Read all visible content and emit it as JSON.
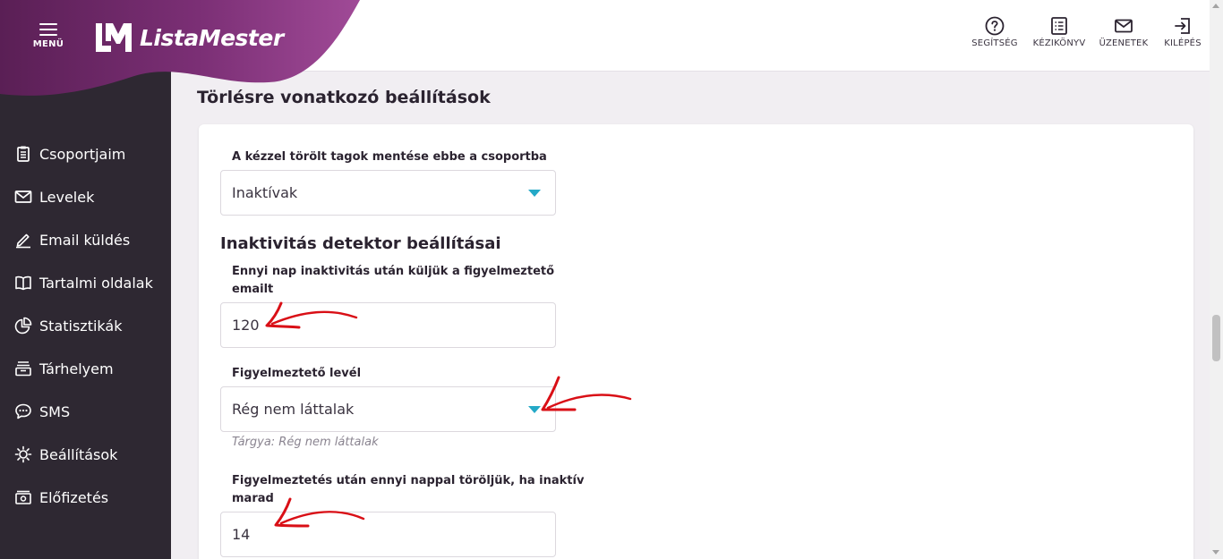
{
  "header": {
    "menu_label": "MENÜ",
    "brand": "ListaMester",
    "actions": [
      {
        "label": "SEGÍTSÉG",
        "icon": "help-circle-icon"
      },
      {
        "label": "KÉZIKÖNYV",
        "icon": "manual-list-icon"
      },
      {
        "label": "ÜZENETEK",
        "icon": "mail-icon"
      },
      {
        "label": "KILÉPÉS",
        "icon": "logout-icon"
      }
    ]
  },
  "sidebar": {
    "items": [
      {
        "label": "Csoportjaim",
        "icon": "clipboard-icon"
      },
      {
        "label": "Levelek",
        "icon": "envelope-icon"
      },
      {
        "label": "Email küldés",
        "icon": "pencil-icon"
      },
      {
        "label": "Tartalmi oldalak",
        "icon": "book-icon"
      },
      {
        "label": "Statisztikák",
        "icon": "pie-chart-icon"
      },
      {
        "label": "Tárhelyem",
        "icon": "storage-icon"
      },
      {
        "label": "SMS",
        "icon": "chat-bubble-icon"
      },
      {
        "label": "Beállítások",
        "icon": "gear-icon"
      },
      {
        "label": "Előfizetés",
        "icon": "subscription-icon"
      }
    ]
  },
  "main": {
    "section_title": "Törlésre vonatkozó beállítások",
    "deleted_members_label": "A kézzel törölt tagok mentése ebbe a csoportba",
    "deleted_members_value": "Inaktívak",
    "inactivity_heading": "Inaktivitás detektor beállításai",
    "days_label_line1": "Ennyi nap inaktivitás után küljük a figyelmeztető",
    "days_label_line2": "emailt",
    "days_value": "120",
    "warning_label": "Figyelmeztető levél",
    "warning_value": "Rég nem láttalak",
    "warning_hint": "Tárgya: Rég nem láttalak",
    "delete_label_line1": "Figyelmeztetés után ennyi nappal töröljük, ha inaktív",
    "delete_label_line2": "marad",
    "delete_value": "14"
  },
  "colors": {
    "brand_purple": "#7a2f74",
    "sidebar_bg": "#2e2832",
    "caret": "#24a9c7",
    "annotation_arrow": "#d90f16"
  }
}
